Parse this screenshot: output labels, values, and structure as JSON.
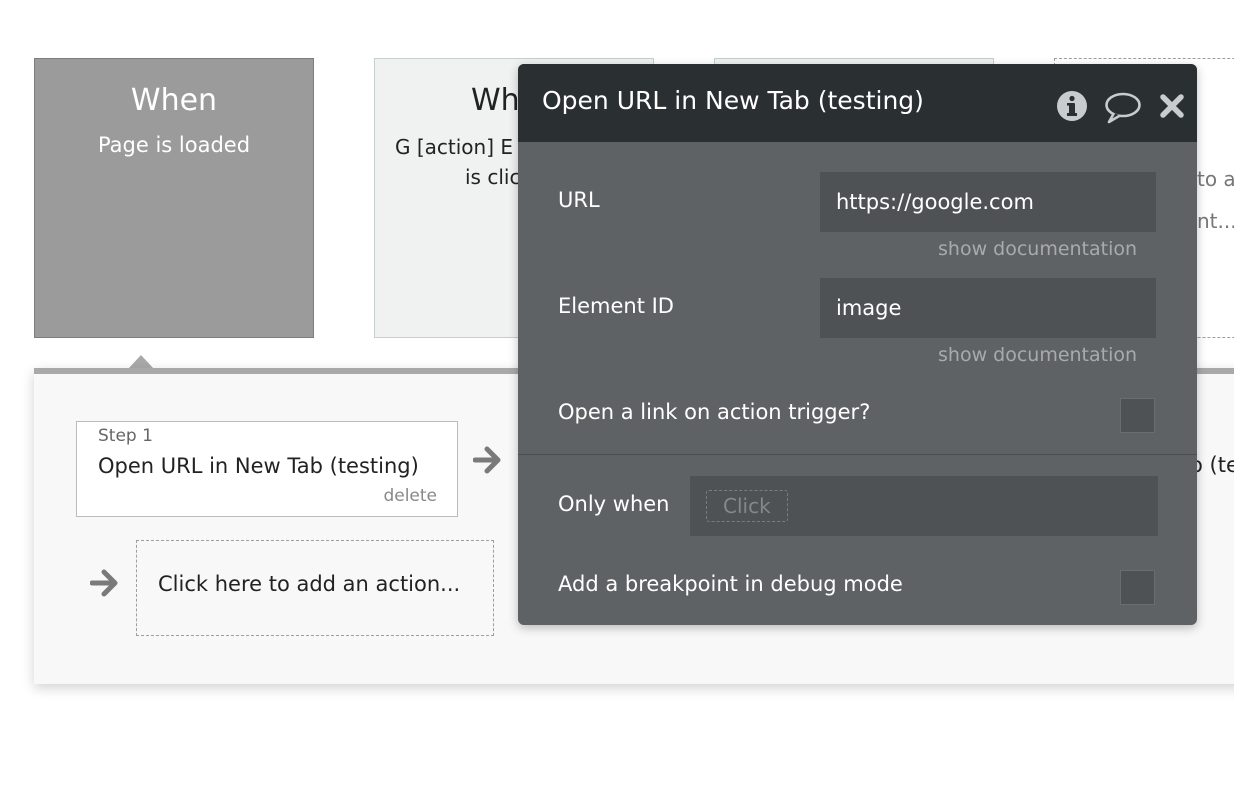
{
  "event_cards": {
    "card1": {
      "title": "When",
      "subtitle": "Page is loaded"
    },
    "card2": {
      "title_fragment": "Wh",
      "line1_fragment": "G [action] E",
      "line2_fragment": "is clic"
    },
    "card4": {
      "line1_fragment": "to a",
      "line2_fragment": "nt..."
    }
  },
  "workflow": {
    "step1": {
      "label": "Step 1",
      "name": "Open URL in New Tab (testing)",
      "delete": "delete"
    },
    "add_action": "Click here to add an action...",
    "step2_fragment": "o (te"
  },
  "popup": {
    "title": "Open URL in New Tab (testing)",
    "icons": {
      "info": "info-icon",
      "comment": "comment-icon",
      "close": "close-icon"
    },
    "fields": {
      "url": {
        "label": "URL",
        "value": "https://google.com",
        "doc": "show documentation"
      },
      "element_id": {
        "label": "Element ID",
        "value": "image",
        "doc": "show documentation"
      },
      "open_link": {
        "label": "Open a link on action trigger?"
      },
      "only_when": {
        "label": "Only when",
        "chip": "Click"
      },
      "breakpoint": {
        "label": "Add a breakpoint in debug mode"
      }
    }
  },
  "colors": {
    "popup_bg": "#5f6265",
    "popup_header": "#2a2f31",
    "when_card": "#9b9b9b"
  }
}
